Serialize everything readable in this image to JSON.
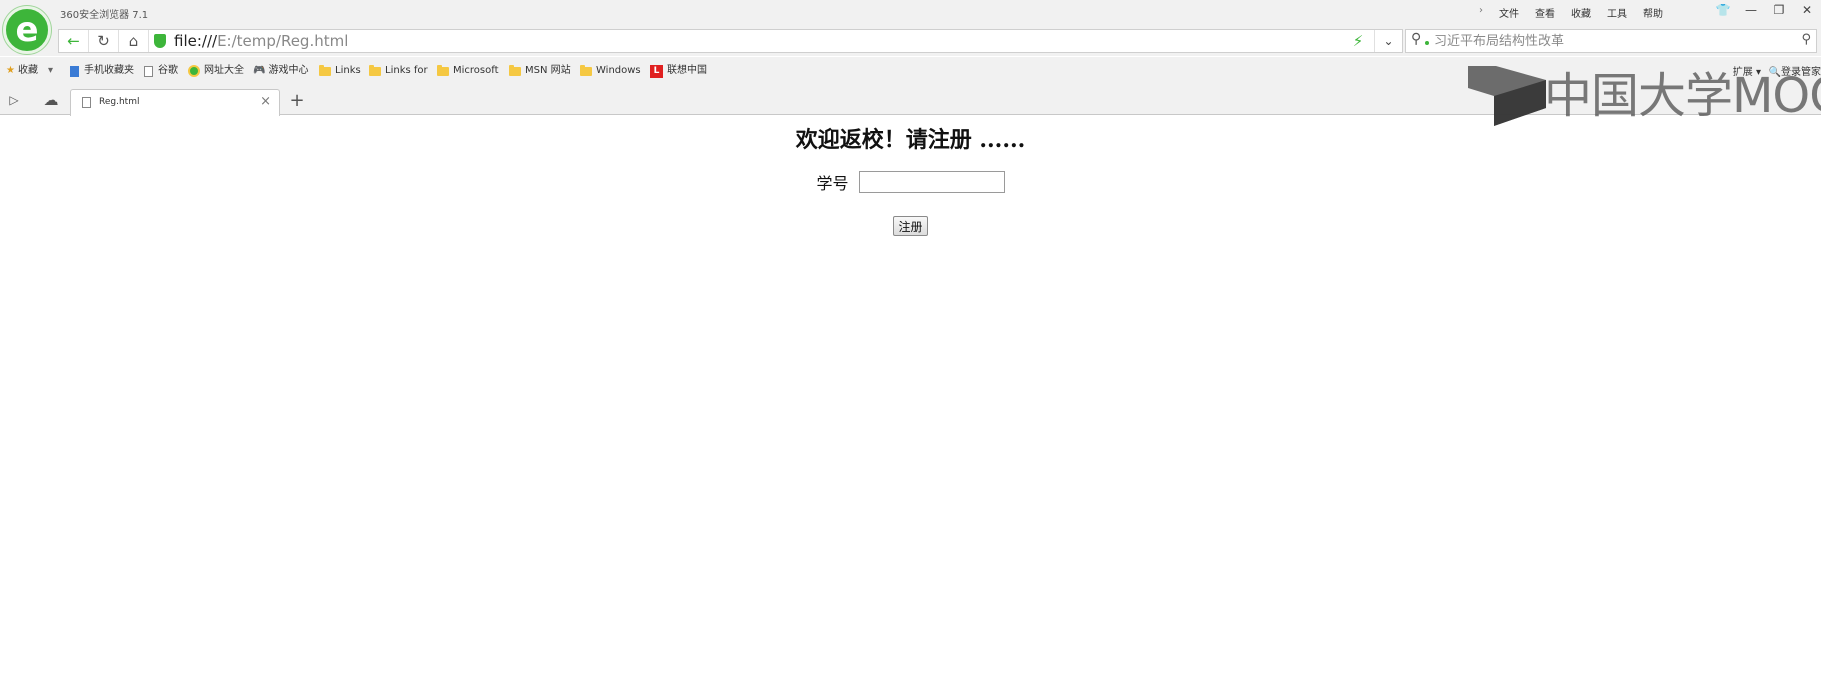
{
  "window": {
    "app_title": "360安全浏览器 7.1",
    "menu": [
      "文件",
      "查看",
      "收藏",
      "工具",
      "帮助"
    ]
  },
  "address": {
    "url_protocol": "file:///",
    "url_path": "E:/temp/Reg.html"
  },
  "search": {
    "placeholder": "习近平布局结构性改革"
  },
  "bookmarks": {
    "favorites_label": "收藏",
    "items": [
      "手机收藏夹",
      "谷歌",
      "网址大全",
      "游戏中心",
      "Links",
      "Links for",
      "Microsoft",
      "MSN 网站",
      "Windows",
      "联想中国"
    ],
    "extensions_label": "扩展",
    "manage_label": "登录管家"
  },
  "tab": {
    "title": "Reg.html"
  },
  "page": {
    "heading": "欢迎返校！请注册 ......",
    "student_id_label": "学号",
    "student_id_value": "",
    "submit_label": "注册"
  },
  "watermark": {
    "text": "中国大学MOOC"
  },
  "colors": {
    "brand_green": "#3db53a",
    "chrome_bg": "#f1f1f1"
  }
}
